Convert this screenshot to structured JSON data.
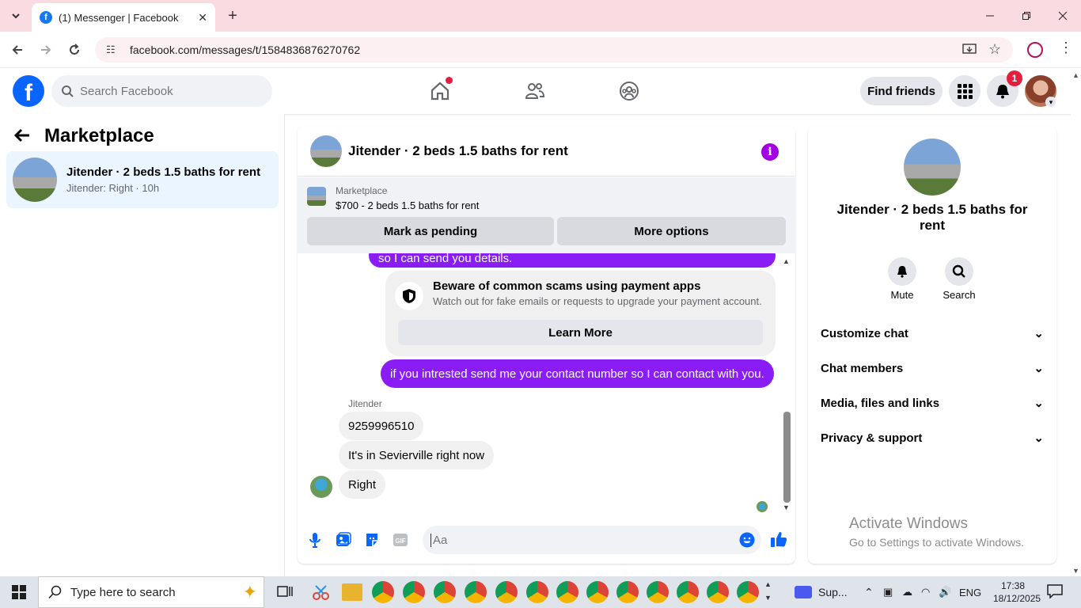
{
  "browser": {
    "tab_title": "(1) Messenger | Facebook",
    "url": "facebook.com/messages/t/1584836876270762",
    "window_controls": [
      "minimize-icon",
      "restore-icon",
      "close-icon"
    ]
  },
  "header": {
    "search_placeholder": "Search Facebook",
    "find_friends_label": "Find friends",
    "notification_count": "1"
  },
  "sidebar": {
    "title": "Marketplace",
    "conversations": [
      {
        "title": "Jitender · 2 beds 1.5 baths for rent",
        "preview": "Jitender: Right · 10h"
      }
    ]
  },
  "chat": {
    "title": "Jitender · 2 beds 1.5 baths for rent",
    "marketplace_label": "Marketplace",
    "listing": "$700 - 2 beds 1.5 baths for rent",
    "mark_pending_label": "Mark as pending",
    "more_options_label": "More options",
    "messages": {
      "out_partial": "so I can send you details.",
      "scam_title": "Beware of common scams using payment apps",
      "scam_desc": "Watch out for fake emails or requests to upgrade your payment account.",
      "learn_more_label": "Learn More",
      "out_contact": "if you intrested send me your contact number so I can contact with you.",
      "sender_name": "Jitender",
      "in_1": "9259996510",
      "in_2": "It's in Sevierville right now",
      "in_3": "Right"
    },
    "input_placeholder": "Aa",
    "accent_color": "#8a1df5"
  },
  "details": {
    "name": "Jitender · 2 beds 1.5 baths for rent",
    "mute_label": "Mute",
    "search_label": "Search",
    "sections": [
      "Customize chat",
      "Chat members",
      "Media, files and links",
      "Privacy & support"
    ]
  },
  "watermark": {
    "line1": "Activate Windows",
    "line2": "Go to Settings to activate Windows."
  },
  "taskbar": {
    "search_placeholder": "Type here to search",
    "app_label": "Sup...",
    "language": "ENG",
    "time": "17:38",
    "date": "18/12/2025"
  }
}
